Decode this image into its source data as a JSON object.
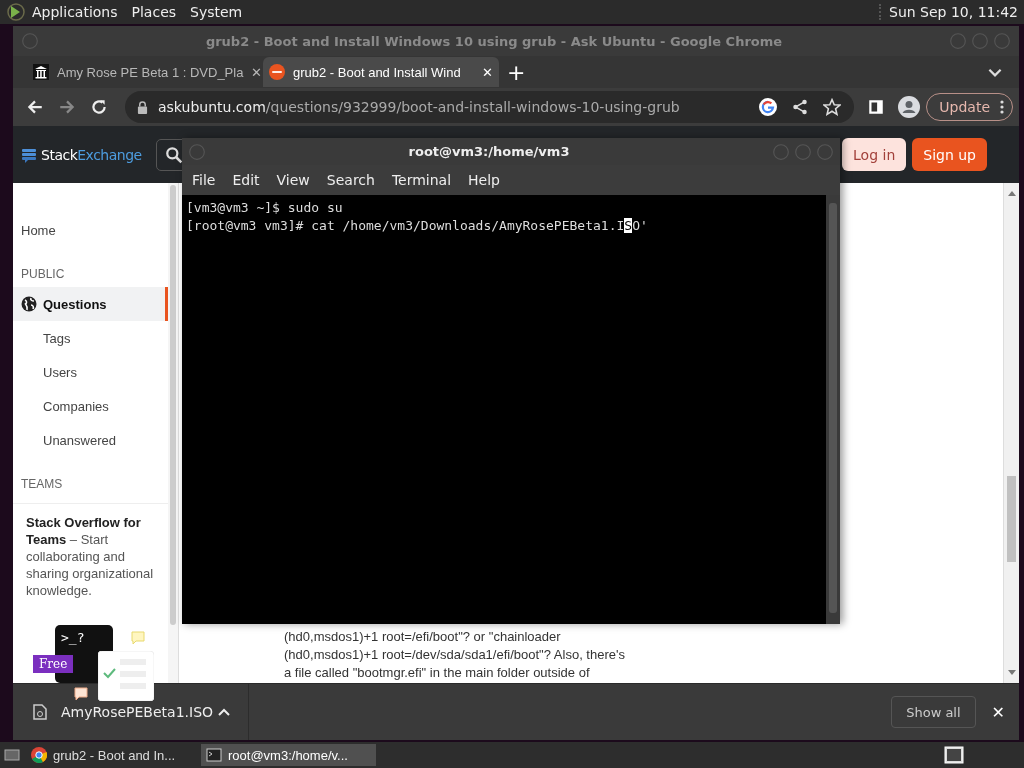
{
  "top_panel": {
    "menus": [
      "Applications",
      "Places",
      "System"
    ],
    "clock": "Sun Sep 10, 11:42"
  },
  "browser": {
    "title": "grub2 - Boot and Install Windows 10 using grub - Ask Ubuntu - Google Chrome",
    "tabs": [
      {
        "label": "Amy Rose PE Beta 1 : DVD_Pla",
        "close": "✕",
        "selected": false,
        "kind": "archive"
      },
      {
        "label": "grub2 - Boot and Install Wind",
        "close": "✕",
        "selected": true,
        "kind": "ask"
      }
    ],
    "new_tab": "+",
    "url": {
      "host": "askubuntu.com",
      "path": "/questions/932999/boot-and-install-windows-10-using-grub"
    },
    "update_button": "Update",
    "page": {
      "logo": {
        "first": "Stack",
        "second": "Exchange"
      },
      "login": "Log in",
      "signup": "Sign up",
      "sidebar": [
        {
          "kind": "link",
          "label": "Home",
          "selected": false
        },
        {
          "kind": "heading",
          "label": "PUBLIC"
        },
        {
          "kind": "globe_link",
          "label": "Questions",
          "selected": true
        },
        {
          "kind": "sublink",
          "label": "Tags",
          "selected": false
        },
        {
          "kind": "sublink",
          "label": "Users",
          "selected": false
        },
        {
          "kind": "sublink",
          "label": "Companies",
          "selected": false
        },
        {
          "kind": "sublink",
          "label": "Unanswered",
          "selected": false
        },
        {
          "kind": "heading",
          "label": "TEAMS"
        }
      ],
      "teams_text": "**Stack Overflow for Teams** – Start collaborating and sharing organizational knowledge.",
      "teams_prompt": ">_?",
      "teams_badge": "Free",
      "body_lines": [
        "(hd0,msdos1)+1 root=/efi/boot\"? or \"chainloader",
        "(hd0,msdos1)+1 root=/dev/sda/sda1/efi/boot\"? Also, there's",
        "a file called \"bootmgr.efi\" in the main folder outside of"
      ]
    },
    "downloads": {
      "file": "AmyRosePEBeta1.ISO",
      "show_all": "Show all",
      "close": "✕"
    }
  },
  "terminal": {
    "title": "root@vm3:/home/vm3",
    "menus": [
      "File",
      "Edit",
      "View",
      "Search",
      "Terminal",
      "Help"
    ],
    "lines": [
      {
        "text": "[vm3@vm3 ~]$ sudo su"
      },
      {
        "text": "[root@vm3 vm3]# cat /home/vm3/Downloads/AmyRosePEBeta1.I",
        "cursor": "S",
        "after": "O'"
      }
    ]
  },
  "taskbar": [
    {
      "label": "grub2 - Boot and In...",
      "kind": "chrome",
      "selected": false
    },
    {
      "label": "root@vm3:/home/v...",
      "kind": "terminal",
      "selected": true
    }
  ]
}
